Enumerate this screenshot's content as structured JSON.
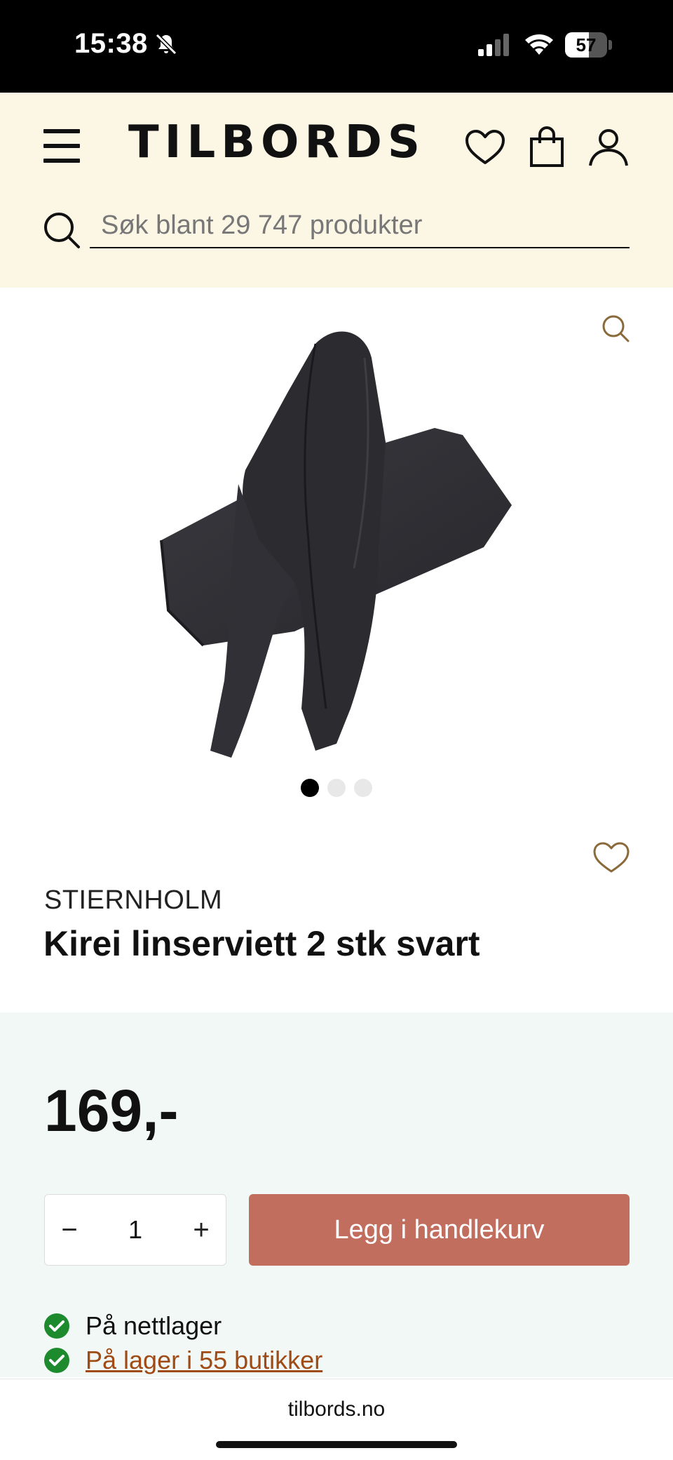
{
  "status_bar": {
    "time": "15:38",
    "battery": "57",
    "battery_level": 0.57
  },
  "header": {
    "logo": "TILBORDS",
    "search_placeholder": "Søk blant 29 747 produkter"
  },
  "gallery": {
    "image_count": 3,
    "active_index": 0
  },
  "product": {
    "brand": "STIERNHOLM",
    "title": "Kirei linserviett 2 stk svart",
    "price": "169,-"
  },
  "cart": {
    "decrement": "−",
    "quantity": "1",
    "increment": "+",
    "add_label": "Legg i handlekurv"
  },
  "stock": {
    "online": "På nettlager",
    "stores_link": "På lager i 55 butikker"
  },
  "browser": {
    "url": "tilbords.no"
  },
  "colors": {
    "header_bg": "#fcf6e4",
    "price_panel_bg": "#f1f8f5",
    "add_button": "#c26e5f",
    "stock_check": "#1e8a2e",
    "link": "#a04a15",
    "accent_icon": "#8a6a3a"
  },
  "icons": [
    "bell-slash-icon",
    "signal-icon",
    "wifi-icon",
    "menu-icon",
    "heart-icon",
    "bag-icon",
    "user-icon",
    "search-icon",
    "zoom-icon",
    "check-icon"
  ]
}
